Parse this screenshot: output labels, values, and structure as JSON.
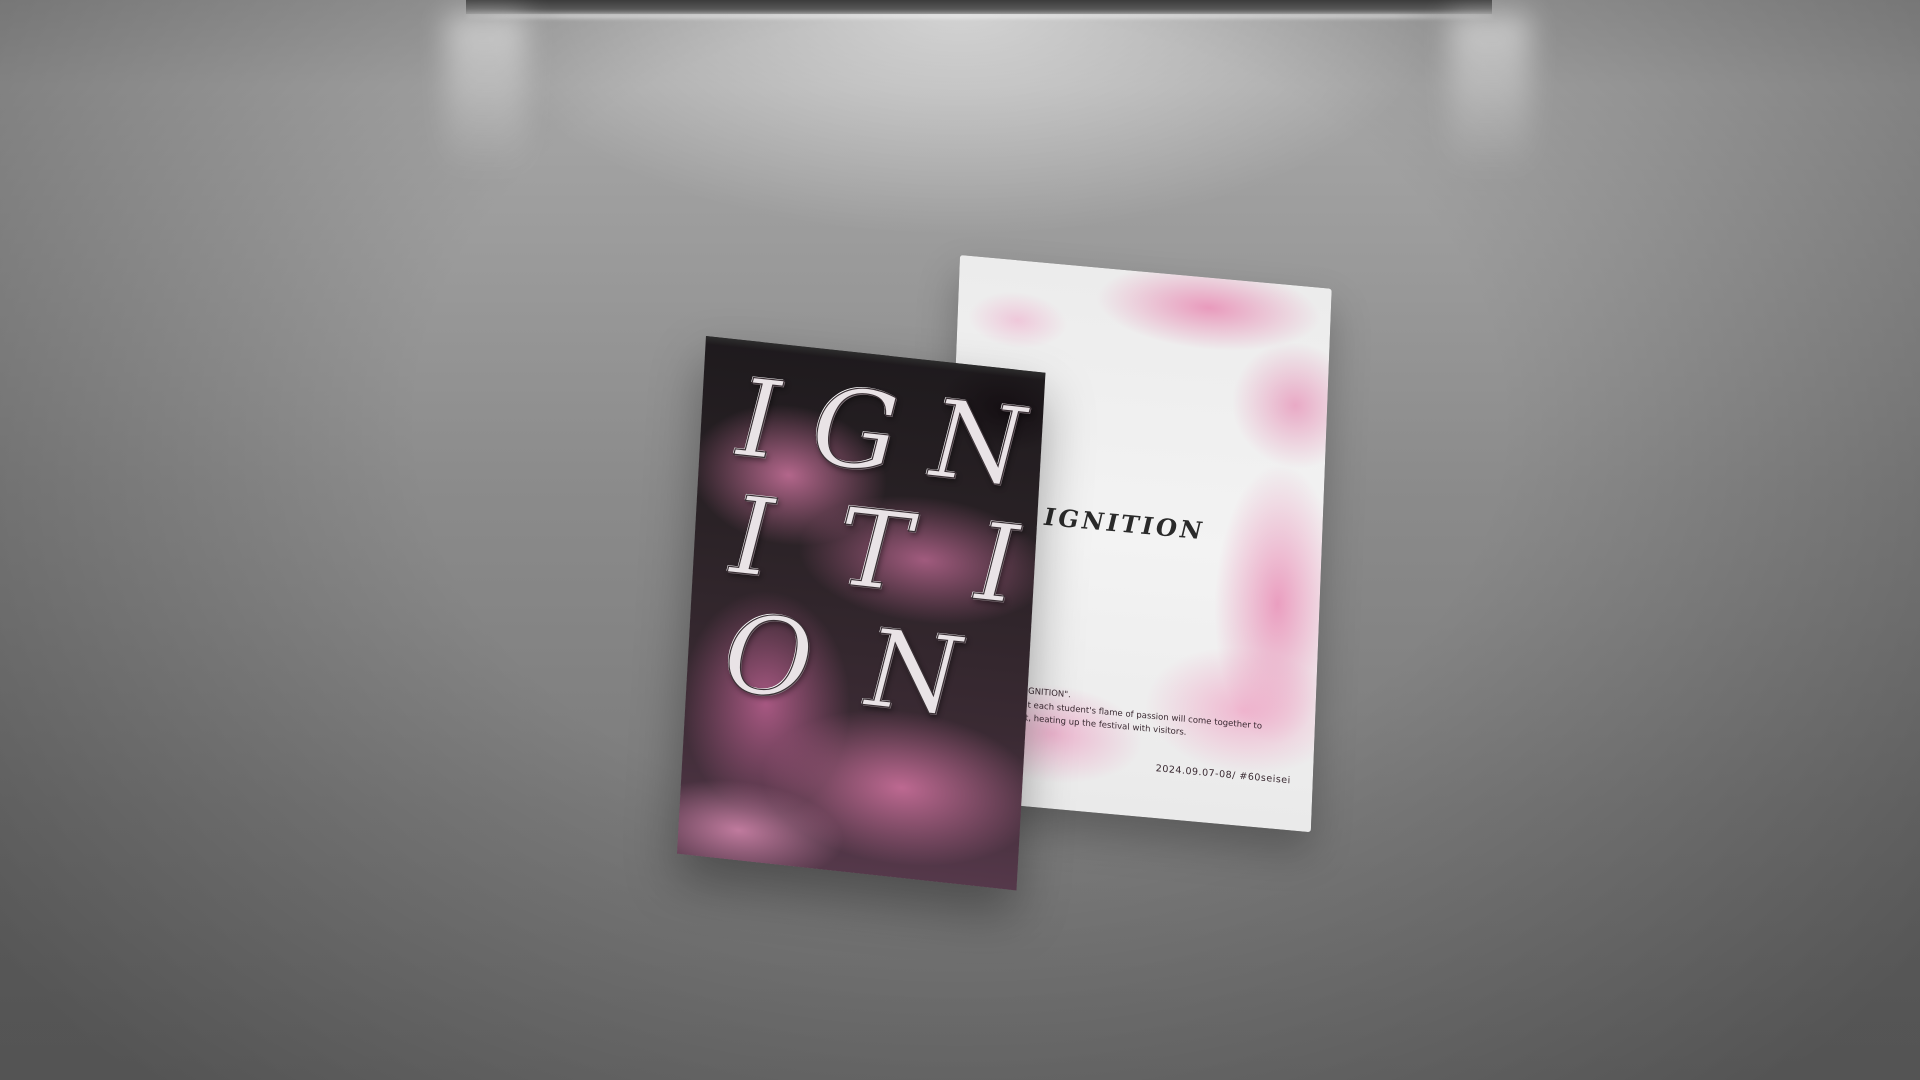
{
  "scene": {
    "background": "#8e8e8e",
    "light_color": "#ffffff"
  },
  "front_folder": {
    "title_rows": [
      [
        "I",
        "G",
        "N"
      ],
      [
        "I",
        "T",
        "I"
      ],
      [
        "O",
        "N",
        ""
      ]
    ],
    "accent_color": "#d37aa6",
    "base_color": "#1e1a1d"
  },
  "back_folder": {
    "brand_name": "IGNITION",
    "copy_lines": [
      "seisaisai is \"IGNITION\".",
      "our hope that each student's flame of passion will come together to",
      "d excitement, heating up the festival with visitors."
    ],
    "date_text": "2024.09.07-08/ #60seisei",
    "accent_color": "#e88cb4"
  }
}
